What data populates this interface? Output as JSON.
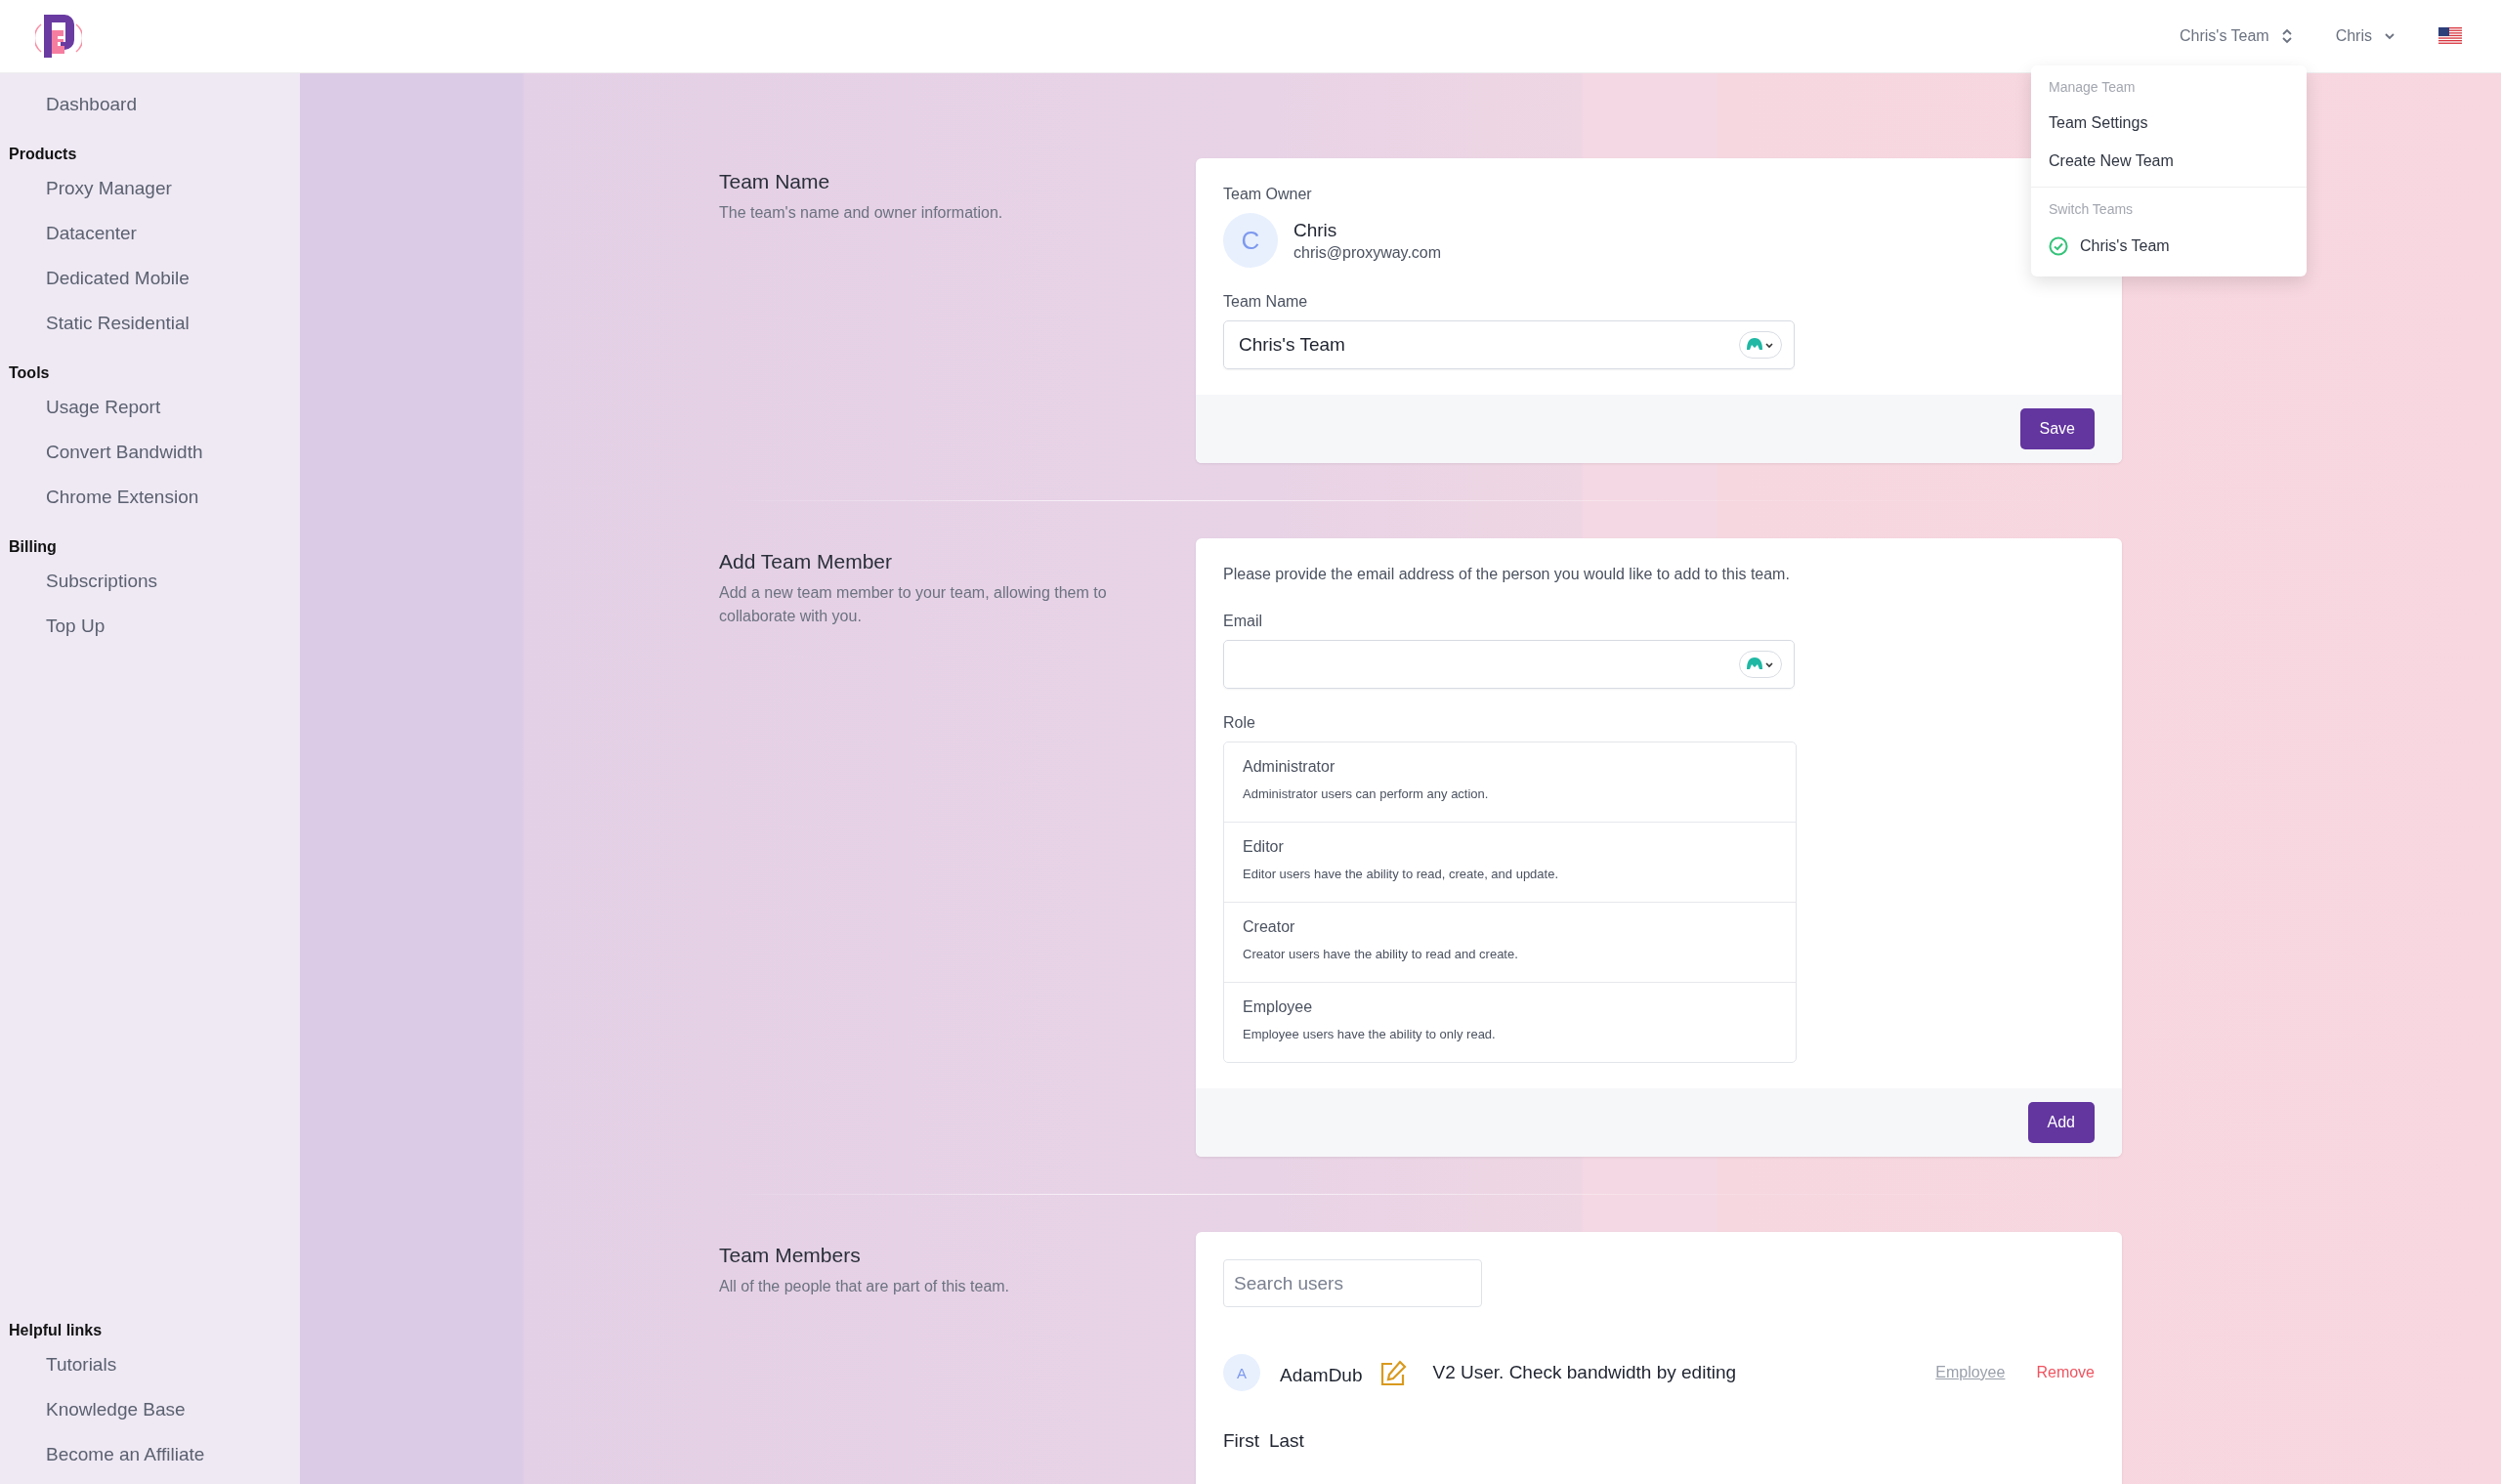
{
  "header": {
    "team_switcher": "Chris's Team",
    "user_menu": "Chris"
  },
  "dropdown": {
    "manage_heading": "Manage Team",
    "items": [
      "Team Settings",
      "Create New Team"
    ],
    "switch_heading": "Switch Teams",
    "teams": [
      {
        "label": "Chris's Team",
        "selected": true
      }
    ]
  },
  "sidebar": {
    "sections": [
      {
        "items": [
          "Dashboard"
        ]
      },
      {
        "heading": "Products",
        "items": [
          "Proxy Manager",
          "Datacenter",
          "Dedicated Mobile",
          "Static Residential"
        ]
      },
      {
        "heading": "Tools",
        "items": [
          "Usage Report",
          "Convert Bandwidth",
          "Chrome Extension"
        ]
      },
      {
        "heading": "Billing",
        "items": [
          "Subscriptions",
          "Top Up"
        ]
      }
    ],
    "footer_section": {
      "heading": "Helpful links",
      "items": [
        "Tutorials",
        "Knowledge Base",
        "Become an Affiliate"
      ]
    }
  },
  "team_name": {
    "title": "Team Name",
    "description": "The team's name and owner information.",
    "owner_label": "Team Owner",
    "owner": {
      "initial": "C",
      "name": "Chris",
      "email": "chris@proxyway.com"
    },
    "field_label": "Team Name",
    "field_value": "Chris's Team",
    "button": "Save"
  },
  "add_member": {
    "title": "Add Team Member",
    "description": "Add a new team member to your team, allowing them to collaborate with you.",
    "intro": "Please provide the email address of the person you would like to add to this team.",
    "email_label": "Email",
    "role_label": "Role",
    "roles": [
      {
        "name": "Administrator",
        "description": "Administrator users can perform any action."
      },
      {
        "name": "Editor",
        "description": "Editor users have the ability to read, create, and update."
      },
      {
        "name": "Creator",
        "description": "Creator users have the ability to read and create."
      },
      {
        "name": "Employee",
        "description": "Employee users have the ability to only read."
      }
    ],
    "button": "Add"
  },
  "members": {
    "title": "Team Members",
    "description": "All of the people that are part of this team.",
    "search_placeholder": "Search users",
    "rows": [
      {
        "initial": "A",
        "name": "AdamDub",
        "note": "V2 User. Check bandwidth by editing",
        "role": "Employee",
        "action": "Remove"
      }
    ],
    "footer_text": [
      "First",
      "Last"
    ]
  }
}
